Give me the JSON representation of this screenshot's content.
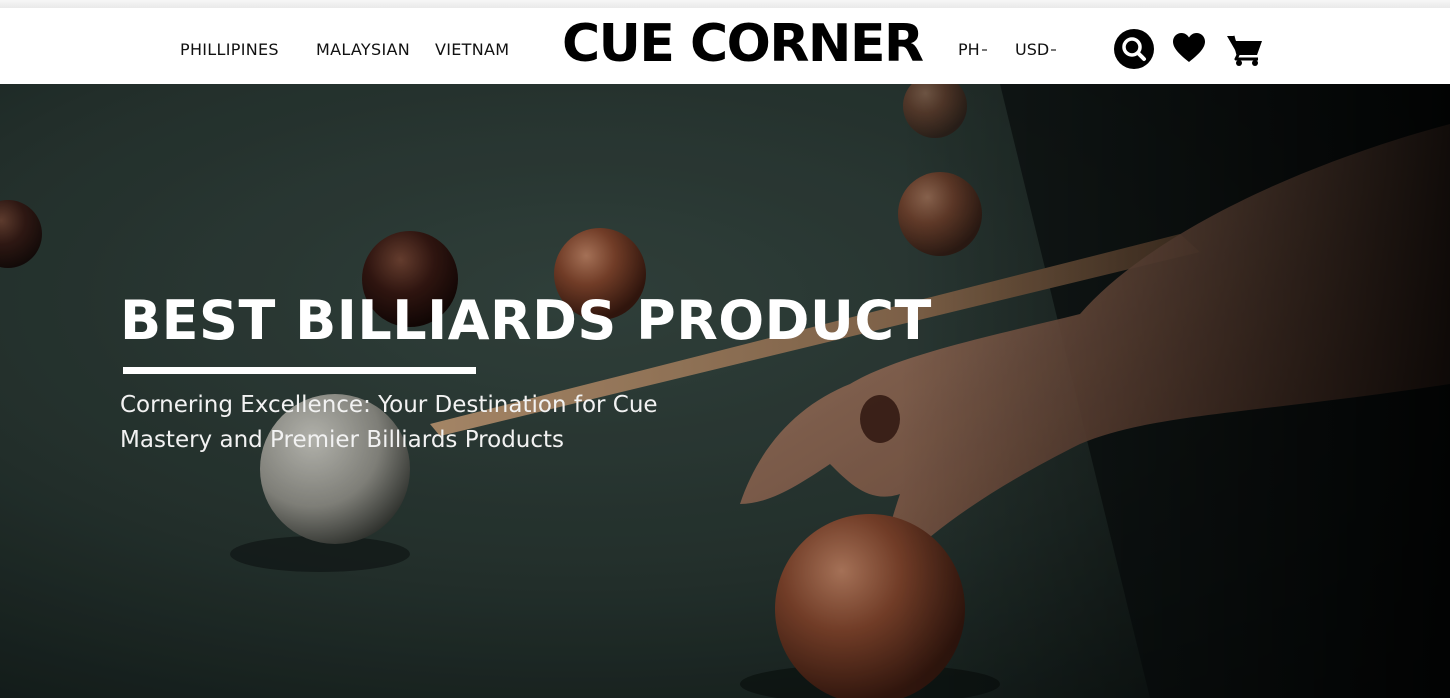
{
  "header": {
    "nav": [
      "PHILLIPINES",
      "MALAYSIAN",
      "VIETNAM"
    ],
    "logo": "CUE CORNER",
    "region_selector": "PH",
    "currency_selector": "USD",
    "icons": [
      "search-icon",
      "heart-icon",
      "cart-icon"
    ]
  },
  "hero": {
    "title": "BEST BILLIARDS PRODUCT",
    "subtitle": "Cornering Excellence: Your Destination for Cue Mastery and Premier Billiards Products"
  },
  "colors": {
    "header_bg": "#ffffff",
    "text_dark": "#000000",
    "felt": "#2a3a36",
    "ball": "#8a4a30",
    "hero_text": "#ffffff"
  }
}
